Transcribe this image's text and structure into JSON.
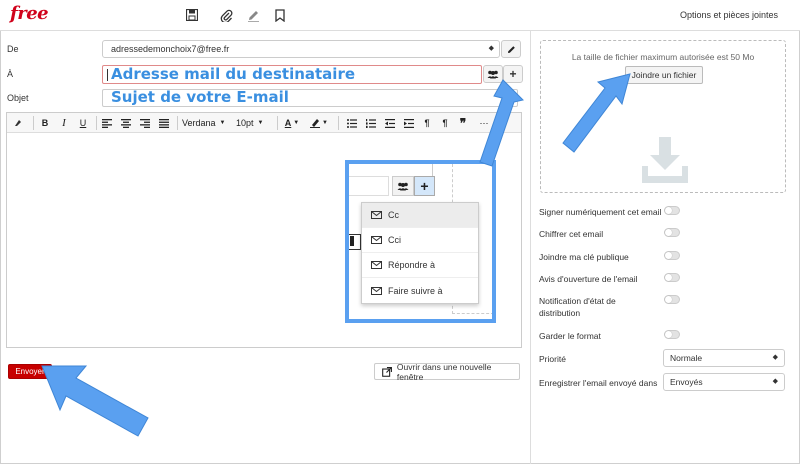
{
  "app": {
    "logo": "free",
    "options_link": "Options et pièces jointes"
  },
  "toolbar_icons": [
    "save-icon",
    "paperclip-icon",
    "pen-icon",
    "bookmark-icon"
  ],
  "form": {
    "from_label": "De",
    "from_value": "adressedemonchoix7@free.fr",
    "to_label": "À",
    "to_value": "Adresse mail du destinataire",
    "subject_label": "Objet",
    "subject_value": "Sujet de votre E-mail"
  },
  "editor_toolbar": {
    "bold": "B",
    "italic": "I",
    "underline": "U",
    "font": "Verdana",
    "size": "10pt",
    "text_color": "A"
  },
  "actions": {
    "send": "Envoyer",
    "new_window": "Ouvrir dans une nouvelle fenêtre"
  },
  "attachments": {
    "max_size_note": "La taille de fichier maximum autorisée est 50 Mo",
    "attach_button": "Joindre un fichier"
  },
  "options": [
    {
      "label": "Signer numériquement cet email",
      "on": false
    },
    {
      "label": "Chiffrer cet email",
      "on": false
    },
    {
      "label": "Joindre ma clé publique",
      "on": false
    },
    {
      "label": "Avis d'ouverture de l'email",
      "on": false
    },
    {
      "label": "Notification d'état de distribution",
      "on": false
    },
    {
      "label": "Garder le format",
      "on": false
    }
  ],
  "priority": {
    "label": "Priorité",
    "value": "Normale"
  },
  "save_sent": {
    "label": "Enregistrer l'email envoyé dans",
    "value": "Envoyés"
  },
  "recipient_menu": {
    "items": [
      "Cc",
      "Cci",
      "Répondre à",
      "Faire suivre à"
    ]
  },
  "colors": {
    "brand": "#d0021b",
    "send_button": "#c70000",
    "annotation_arrow": "#5aa0f0",
    "annotation_text": "#3a8fe0"
  }
}
